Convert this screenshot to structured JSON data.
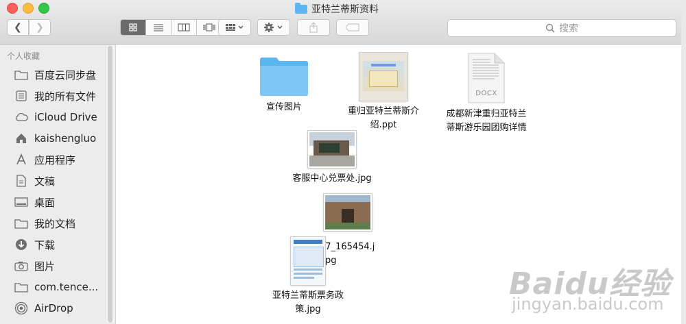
{
  "window": {
    "title": "亚特兰蒂斯资料"
  },
  "toolbar": {
    "back_icon": "chevron-left-icon",
    "forward_icon": "chevron-right-icon",
    "views": [
      "icon-view",
      "list-view",
      "column-view",
      "cover-flow-view"
    ],
    "active_view": "icon-view",
    "search_placeholder": "搜索"
  },
  "sidebar": {
    "header": "个人收藏",
    "items": [
      {
        "label": "百度云同步盘",
        "icon": "folder-icon"
      },
      {
        "label": "我的所有文件",
        "icon": "all-files-icon"
      },
      {
        "label": "iCloud Drive",
        "icon": "cloud-icon"
      },
      {
        "label": "kaishengluo",
        "icon": "home-icon"
      },
      {
        "label": "应用程序",
        "icon": "applications-icon"
      },
      {
        "label": "文稿",
        "icon": "documents-icon"
      },
      {
        "label": "桌面",
        "icon": "desktop-icon"
      },
      {
        "label": "我的文档",
        "icon": "folder-icon"
      },
      {
        "label": "下载",
        "icon": "download-icon"
      },
      {
        "label": "图片",
        "icon": "camera-icon"
      },
      {
        "label": "com.tence...",
        "icon": "folder-icon"
      },
      {
        "label": "AirDrop",
        "icon": "airdrop-icon"
      }
    ]
  },
  "files": [
    {
      "name": "宣传图片",
      "kind": "folder"
    },
    {
      "name": "重归亚特兰蒂斯介绍.ppt",
      "name_lines": [
        "重归亚特兰蒂斯介",
        "绍.ppt"
      ],
      "kind": "ppt"
    },
    {
      "name": "成都新津重归亚特兰蒂斯游乐园团购详情",
      "name_lines": [
        "成都新津重归亚特兰",
        "蒂斯游乐园团购详情"
      ],
      "kind": "docx",
      "badge": "DOCX"
    },
    {
      "name": "客服中心兑票处.jpg",
      "kind": "jpg"
    },
    {
      "name": "17_165454.jpg",
      "name_lines": [
        "17_165454.j",
        "pg"
      ],
      "kind": "jpg"
    },
    {
      "name": "亚特兰蒂斯票务政策.jpg",
      "name_lines": [
        "亚特兰蒂斯票务政",
        "策.jpg"
      ],
      "kind": "jpg"
    }
  ],
  "watermark": {
    "logo": "Baidu经验",
    "url": "jingyan.baidu.com"
  }
}
